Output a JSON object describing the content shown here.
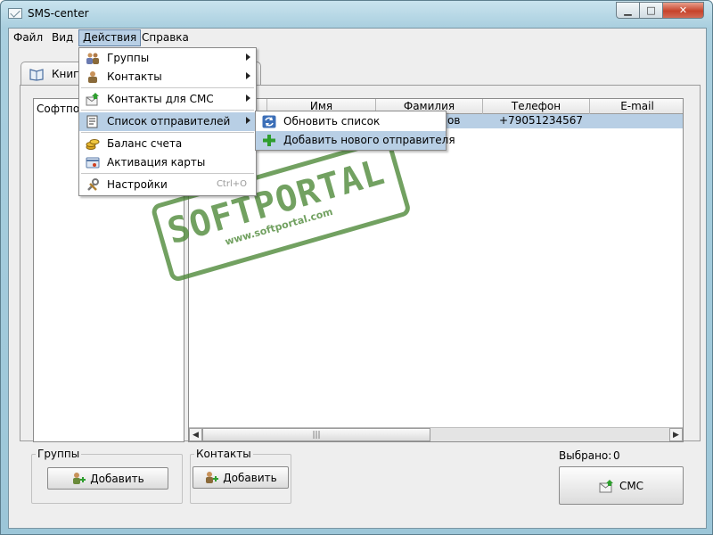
{
  "window": {
    "title": "SMS-center",
    "min_glyph": "▁",
    "max_glyph": "□",
    "close_glyph": "✕"
  },
  "menubar": {
    "items": [
      {
        "label": "Файл"
      },
      {
        "label": "Вид"
      },
      {
        "label": "Действия"
      },
      {
        "label": "Справка"
      }
    ]
  },
  "actions_menu": {
    "items": [
      {
        "label": "Группы",
        "icon": "groups-icon"
      },
      {
        "label": "Контакты",
        "icon": "contacts-icon"
      },
      {
        "label": "Контакты для СМС",
        "icon": "sms-contacts-icon"
      },
      {
        "label": "Список отправителей",
        "icon": "sender-list-icon"
      },
      {
        "label": "Баланс счета",
        "icon": "coins-icon"
      },
      {
        "label": "Активация карты",
        "icon": "card-icon"
      },
      {
        "label": "Настройки",
        "icon": "tools-icon",
        "accel": "Ctrl+O"
      }
    ]
  },
  "senders_submenu": {
    "items": [
      {
        "label": "Обновить список",
        "icon": "refresh-icon"
      },
      {
        "label": "Добавить нового отправителя",
        "icon": "add-icon"
      }
    ]
  },
  "tab": {
    "label": "Книга"
  },
  "tree": {
    "root_label": "Софтпор"
  },
  "table": {
    "columns": [
      "",
      "Имя",
      "Фамилия",
      "Телефон",
      "E-mail"
    ],
    "rows": [
      {
        "first": "",
        "name": "",
        "surname": "ов",
        "phone": "+79051234567",
        "email": ""
      }
    ],
    "scroll_grip": "|||"
  },
  "groups_box": {
    "title": "Группы",
    "add_label": "Добавить"
  },
  "contacts_box": {
    "title": "Контакты",
    "add_label": "Добавить"
  },
  "selected": {
    "label": "Выбрано:",
    "count": "0"
  },
  "sms_button": {
    "label": "СМС"
  },
  "watermark": {
    "text": "SOFTPORTAL",
    "url": "www.softportal.com",
    "tm": "™"
  }
}
